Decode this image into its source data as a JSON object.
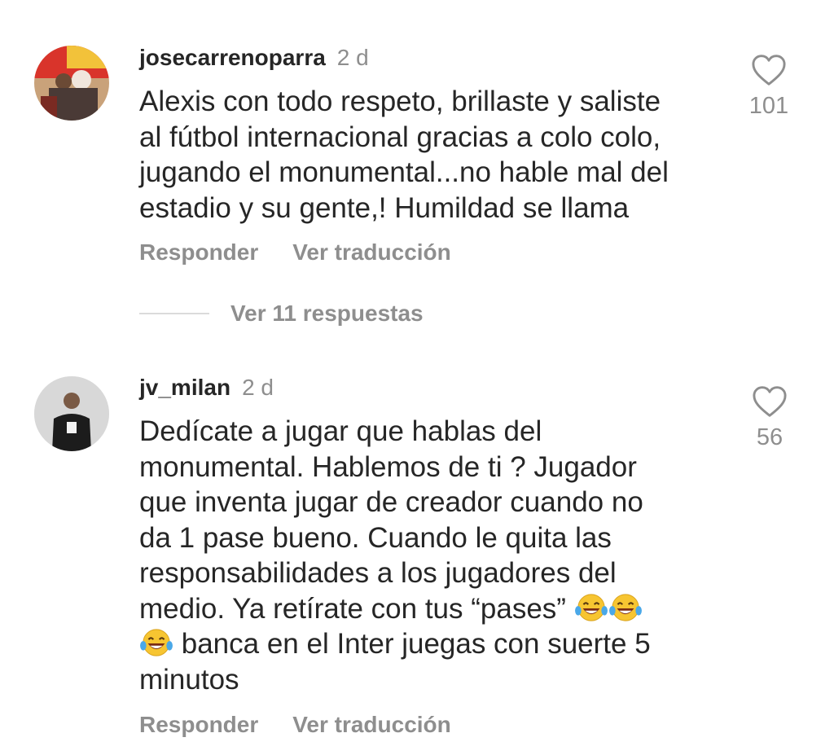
{
  "comments": [
    {
      "username": "josecarrenoparra",
      "time": "2 d",
      "text": "Alexis con todo respeto, brillaste y saliste\nal fútbol internacional gracias a colo colo,\njugando el monumental...no hable mal del\nestadio y su gente,! Humildad se llama",
      "likes": "101",
      "reply_label": "Responder",
      "translate_label": "Ver traducción",
      "view_replies": "Ver 11 respuestas"
    },
    {
      "username": "jv_milan",
      "time": "2 d",
      "text_lines": [
        "Dedícate a jugar que hablas del",
        "monumental. Hablemos de ti ? Jugador",
        "que inventa jugar de creador cuando no",
        "da 1 pase bueno. Cuando le quita las",
        "responsabilidades a los jugadores del"
      ],
      "text_line6": "medio. Ya retírate con tus “pases”",
      "text_line7": "banca en el Inter juegas con suerte 5",
      "text_line8": "minutos",
      "likes": "56",
      "reply_label": "Responder",
      "translate_label": "Ver traducción"
    }
  ],
  "icons": {
    "like": "heart-outline-icon",
    "emoji": "face-with-tears-of-joy"
  },
  "colors": {
    "text": "#262626",
    "secondary": "#8e8e8e",
    "divider": "#dbdbdb"
  }
}
